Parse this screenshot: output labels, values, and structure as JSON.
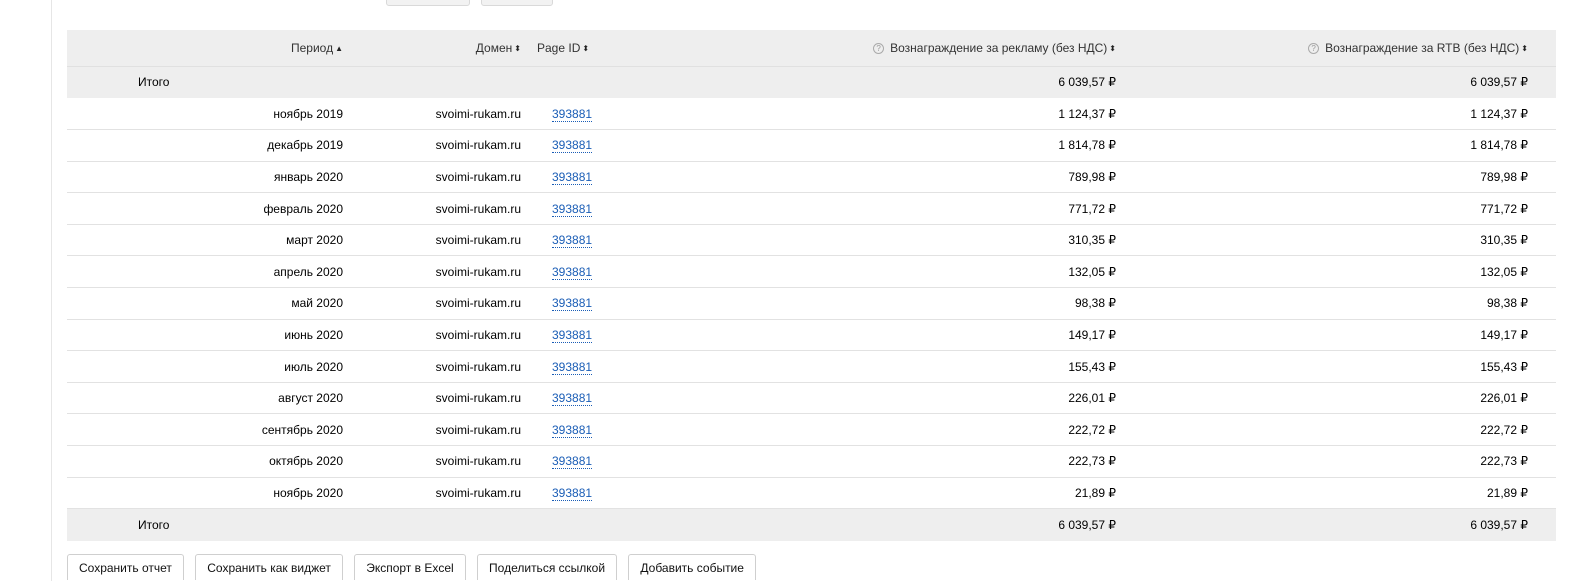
{
  "table": {
    "headers": {
      "period": "Период",
      "domain": "Домен",
      "page_id": "Page ID",
      "reward_ads": "Вознаграждение за рекламу (без НДС)",
      "reward_rtb": "Вознаграждение за RTB (без НДС)"
    },
    "sort_asc_glyph": "▲",
    "sort_both_glyph": "⬍",
    "help_glyph": "?",
    "total_top": {
      "label": "Итого",
      "reward_ads": "6 039,57 ₽",
      "reward_rtb": "6 039,57 ₽"
    },
    "rows": [
      {
        "period": "ноябрь 2019",
        "domain": "svoimi-rukam.ru",
        "page_id": "393881",
        "reward_ads": "1 124,37 ₽",
        "reward_rtb": "1 124,37 ₽"
      },
      {
        "period": "декабрь 2019",
        "domain": "svoimi-rukam.ru",
        "page_id": "393881",
        "reward_ads": "1 814,78 ₽",
        "reward_rtb": "1 814,78 ₽"
      },
      {
        "period": "январь 2020",
        "domain": "svoimi-rukam.ru",
        "page_id": "393881",
        "reward_ads": "789,98 ₽",
        "reward_rtb": "789,98 ₽"
      },
      {
        "period": "февраль 2020",
        "domain": "svoimi-rukam.ru",
        "page_id": "393881",
        "reward_ads": "771,72 ₽",
        "reward_rtb": "771,72 ₽"
      },
      {
        "period": "март 2020",
        "domain": "svoimi-rukam.ru",
        "page_id": "393881",
        "reward_ads": "310,35 ₽",
        "reward_rtb": "310,35 ₽"
      },
      {
        "period": "апрель 2020",
        "domain": "svoimi-rukam.ru",
        "page_id": "393881",
        "reward_ads": "132,05 ₽",
        "reward_rtb": "132,05 ₽"
      },
      {
        "period": "май 2020",
        "domain": "svoimi-rukam.ru",
        "page_id": "393881",
        "reward_ads": "98,38 ₽",
        "reward_rtb": "98,38 ₽"
      },
      {
        "period": "июнь 2020",
        "domain": "svoimi-rukam.ru",
        "page_id": "393881",
        "reward_ads": "149,17 ₽",
        "reward_rtb": "149,17 ₽"
      },
      {
        "period": "июль 2020",
        "domain": "svoimi-rukam.ru",
        "page_id": "393881",
        "reward_ads": "155,43 ₽",
        "reward_rtb": "155,43 ₽"
      },
      {
        "period": "август 2020",
        "domain": "svoimi-rukam.ru",
        "page_id": "393881",
        "reward_ads": "226,01 ₽",
        "reward_rtb": "226,01 ₽"
      },
      {
        "period": "сентябрь 2020",
        "domain": "svoimi-rukam.ru",
        "page_id": "393881",
        "reward_ads": "222,72 ₽",
        "reward_rtb": "222,72 ₽"
      },
      {
        "period": "октябрь 2020",
        "domain": "svoimi-rukam.ru",
        "page_id": "393881",
        "reward_ads": "222,73 ₽",
        "reward_rtb": "222,73 ₽"
      },
      {
        "period": "ноябрь 2020",
        "domain": "svoimi-rukam.ru",
        "page_id": "393881",
        "reward_ads": "21,89 ₽",
        "reward_rtb": "21,89 ₽"
      }
    ],
    "total_bottom": {
      "label": "Итого",
      "reward_ads": "6 039,57 ₽",
      "reward_rtb": "6 039,57 ₽"
    }
  },
  "actions": {
    "save_report": "Сохранить отчет",
    "save_widget": "Сохранить как виджет",
    "export_excel": "Экспорт в Excel",
    "share_link": "Поделиться ссылкой",
    "add_event": "Добавить событие"
  },
  "colors": {
    "header_bg": "#eeeeee",
    "link": "#1a5db6",
    "row_border": "#e2e2e2"
  }
}
